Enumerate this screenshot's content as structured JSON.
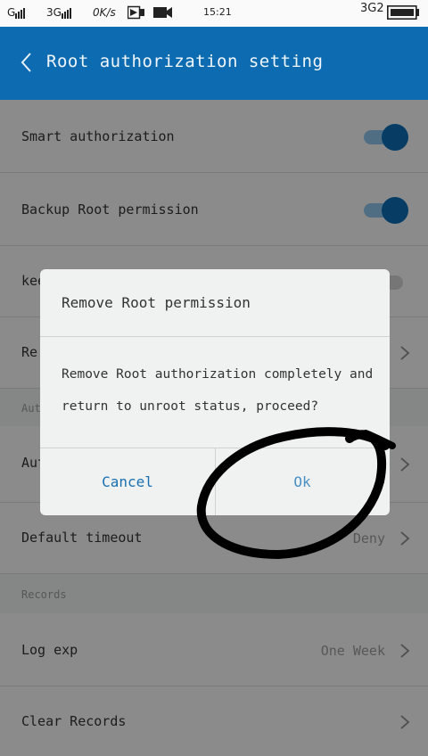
{
  "status_bar": {
    "carrier_left": "G",
    "network": "3G",
    "speed": "0K/s",
    "time": "15:21",
    "network_right": "3G2"
  },
  "header": {
    "title": "Root authorization setting"
  },
  "settings": {
    "smart_authorization": {
      "label": "Smart authorization",
      "enabled": true
    },
    "backup_root": {
      "label": "Backup Root permission",
      "enabled": true
    },
    "keep_row": {
      "label_partial": "kee",
      "enabled": false
    },
    "remove_row": {
      "label_partial": "Re"
    },
    "section_auth": {
      "label_partial": "Aut"
    },
    "auth_row": {
      "label_partial": "Aut"
    },
    "default_timeout": {
      "label": "Default timeout",
      "value": "Deny"
    },
    "section_records": {
      "label": "Records"
    },
    "log_exp": {
      "label": "Log exp",
      "value": "One Week"
    },
    "clear_records": {
      "label": "Clear Records"
    }
  },
  "dialog": {
    "title": "Remove Root permission",
    "message": "Remove Root authorization completely and return to unroot status, proceed?",
    "cancel_label": "Cancel",
    "ok_label": "Ok"
  },
  "colors": {
    "accent": "#0d6bb2",
    "toggle_track": "#8ec2e6",
    "button_text": "#1a6fb0",
    "annotation": "#000000"
  },
  "icons": [
    "back-arrow-icon",
    "chevron-right-icon",
    "signal-icon",
    "video-icon",
    "camera-icon",
    "battery-icon"
  ]
}
